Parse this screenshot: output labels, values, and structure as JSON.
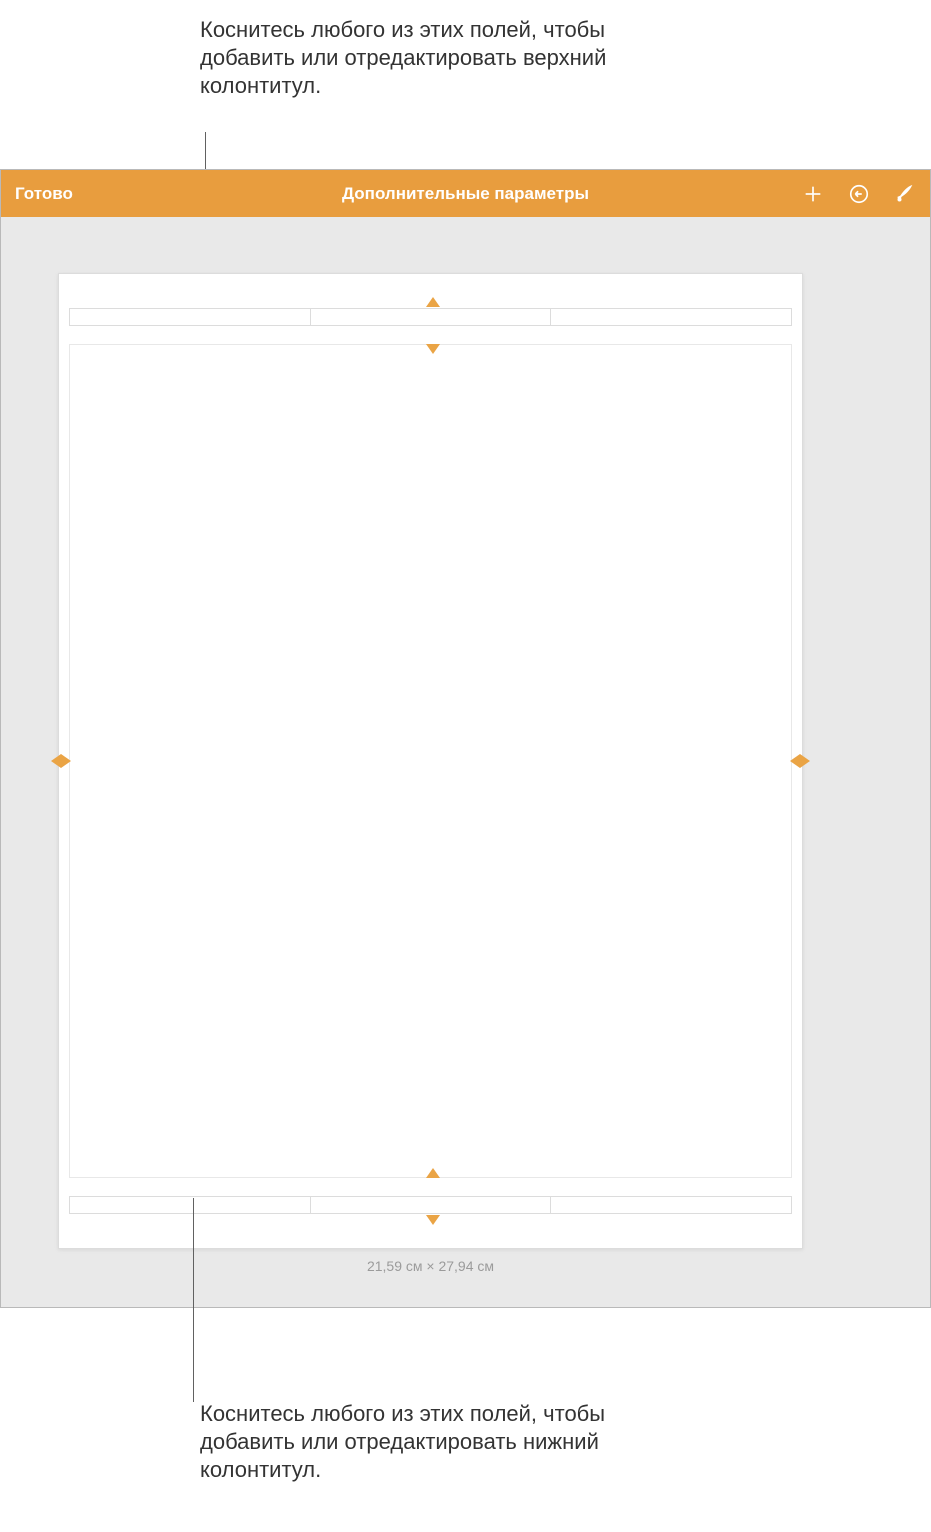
{
  "callouts": {
    "top": "Коснитесь любого из этих полей, чтобы добавить или отредактировать верхний колонтитул.",
    "bottom": "Коснитесь любого из этих полей, чтобы добавить или отредактировать нижний колонтитул."
  },
  "toolbar": {
    "done_label": "Готово",
    "title": "Дополнительные параметры",
    "icons": {
      "add": "plus-icon",
      "undo": "undo-icon",
      "format": "brush-icon"
    }
  },
  "page": {
    "size_label": "21,59 см × 27,94 см"
  },
  "colors": {
    "accent": "#e89d3e"
  }
}
